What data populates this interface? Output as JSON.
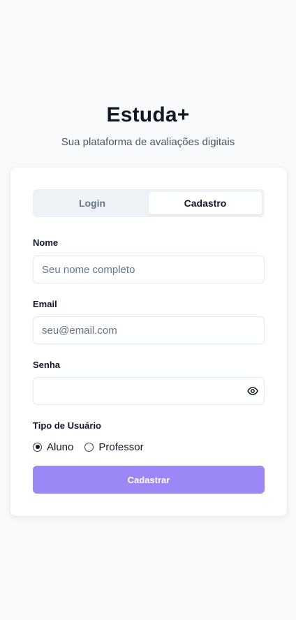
{
  "header": {
    "title": "Estuda+",
    "subtitle": "Sua plataforma de avaliações digitais"
  },
  "tabs": [
    {
      "label": "Login",
      "active": false
    },
    {
      "label": "Cadastro",
      "active": true
    }
  ],
  "form": {
    "name": {
      "label": "Nome",
      "value": "",
      "placeholder": "Seu nome completo"
    },
    "email": {
      "label": "Email",
      "value": "",
      "placeholder": "seu@email.com"
    },
    "password": {
      "label": "Senha",
      "value": "",
      "placeholder": "",
      "toggle_icon": "eye-icon"
    },
    "user_type": {
      "label": "Tipo de Usuário",
      "options": [
        {
          "label": "Aluno",
          "selected": true
        },
        {
          "label": "Professor",
          "selected": false
        }
      ]
    },
    "submit_label": "Cadastrar"
  },
  "colors": {
    "primary": "#9b87f5",
    "background": "#f8f9fb",
    "text": "#0f172a"
  }
}
